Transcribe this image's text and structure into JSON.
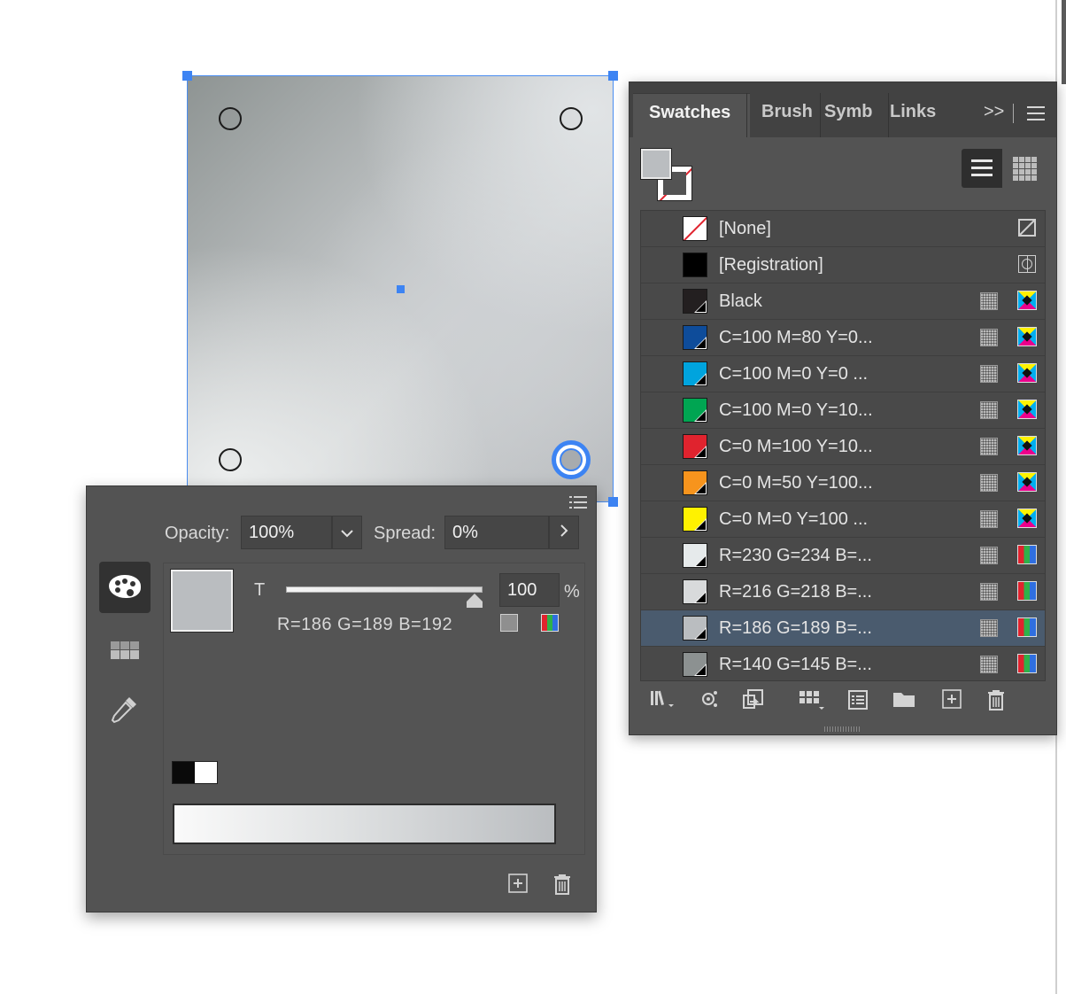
{
  "swatches_panel": {
    "tabs": [
      "Swatches",
      "Brush",
      "Symb",
      "Links"
    ],
    "more_label": ">>",
    "items": [
      {
        "name": "[None]",
        "color": "none",
        "type_icon": "none-lock-icon",
        "mode": ""
      },
      {
        "name": "[Registration]",
        "color": "#000000",
        "type_icon": "registration-icon",
        "mode": ""
      },
      {
        "name": "Black",
        "color": "#231f20",
        "type_icon": "process-icon",
        "mode": "cmyk-icon"
      },
      {
        "name": "C=100 M=80 Y=0...",
        "color": "#0e4c9a",
        "type_icon": "process-icon",
        "mode": "cmyk-icon"
      },
      {
        "name": "C=100 M=0 Y=0 ...",
        "color": "#00a4de",
        "type_icon": "process-icon",
        "mode": "cmyk-icon"
      },
      {
        "name": "C=100 M=0 Y=10...",
        "color": "#00a552",
        "type_icon": "process-icon",
        "mode": "cmyk-icon"
      },
      {
        "name": "C=0 M=100 Y=10...",
        "color": "#e0232e",
        "type_icon": "process-icon",
        "mode": "cmyk-icon"
      },
      {
        "name": "C=0 M=50 Y=100...",
        "color": "#f7941d",
        "type_icon": "process-icon",
        "mode": "cmyk-icon"
      },
      {
        "name": "C=0 M=0 Y=100 ...",
        "color": "#fff200",
        "type_icon": "process-icon",
        "mode": "cmyk-icon"
      },
      {
        "name": "R=230 G=234 B=...",
        "color": "#e6eaeb",
        "type_icon": "process-icon",
        "mode": "rgb-icon"
      },
      {
        "name": "R=216 G=218 B=...",
        "color": "#d8dadb",
        "type_icon": "process-icon",
        "mode": "rgb-icon"
      },
      {
        "name": "R=186 G=189 B=...",
        "color": "#babdc0",
        "type_icon": "process-icon",
        "mode": "rgb-icon",
        "selected": true
      },
      {
        "name": "R=140 G=145 B=...",
        "color": "#8c9191",
        "type_icon": "process-icon",
        "mode": "rgb-icon"
      }
    ],
    "bottom_icons": [
      "swatch-libraries-icon",
      "show-kinds-icon",
      "place-swatches-icon",
      "new-color-group-icon",
      "swatch-options-icon",
      "folder-icon",
      "new-swatch-icon",
      "trash-icon"
    ]
  },
  "gradient_panel": {
    "opacity_label": "Opacity:",
    "opacity_value": "100%",
    "spread_label": "Spread:",
    "spread_value": "0%",
    "tint_label": "T",
    "tint_value": "100",
    "tint_fraction": 1.0,
    "percent_sign": "%",
    "color_readout": "R=186 G=189 B=192",
    "stop_color": "#babdc0",
    "side_icons": [
      "color-palette-icon",
      "swatches-grid-icon",
      "eyedropper-icon"
    ]
  },
  "colors": {
    "selection": "#3d84f3",
    "panel_bg": "#535353"
  }
}
